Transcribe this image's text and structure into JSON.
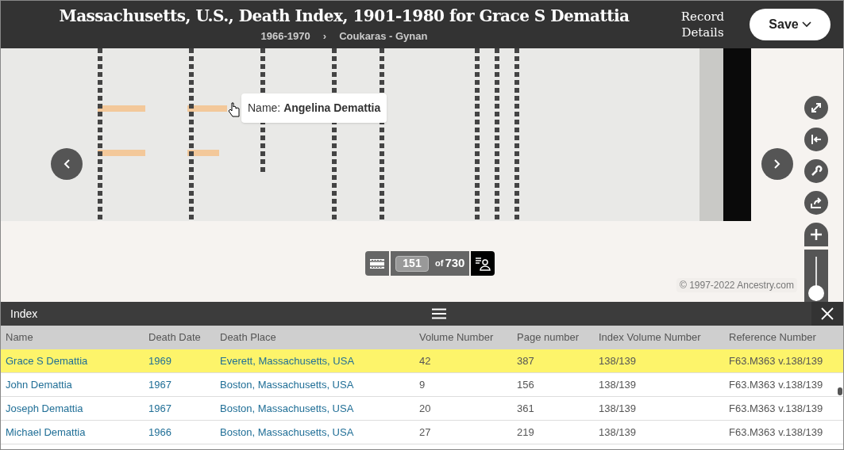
{
  "header": {
    "title": "Massachusetts, U.S., Death Index, 1901-1980 for Grace S Demattia",
    "breadcrumb": [
      "1966-1970",
      "Coukaras - Gynan"
    ],
    "breadcrumb_separator": "›",
    "record_details": "Record Details",
    "save": "Save"
  },
  "viewer": {
    "tooltip": "Name: **Angelina Demattia**",
    "page": {
      "current": "151",
      "of": "of",
      "total": "730"
    },
    "copyright": "© 1997-2022 Ancestry.com",
    "zoom": {
      "level": 0
    }
  },
  "index": {
    "title": "Index",
    "columns": [
      "Name",
      "Death Date",
      "Death Place",
      "Volume Number",
      "Page number",
      "Index Volume Number",
      "Reference Number"
    ],
    "rows": [
      {
        "selected": true,
        "cells": [
          "Grace S Demattia",
          "1969",
          "Everett, Massachusetts, USA",
          "42",
          "387",
          "138/139",
          "F63.M363 v.138/139"
        ]
      },
      {
        "selected": false,
        "cells": [
          "John Demattia",
          "1967",
          "Boston, Massachusetts, USA",
          "9",
          "156",
          "138/139",
          "F63.M363 v.138/139"
        ]
      },
      {
        "selected": false,
        "cells": [
          "Joseph Demattia",
          "1967",
          "Boston, Massachusetts, USA",
          "20",
          "361",
          "138/139",
          "F63.M363 v.138/139"
        ]
      },
      {
        "selected": false,
        "cells": [
          "Michael Demattia",
          "1966",
          "Boston, Massachusetts, USA",
          "27",
          "219",
          "138/139",
          "F63.M363 v.138/139"
        ]
      }
    ]
  }
}
